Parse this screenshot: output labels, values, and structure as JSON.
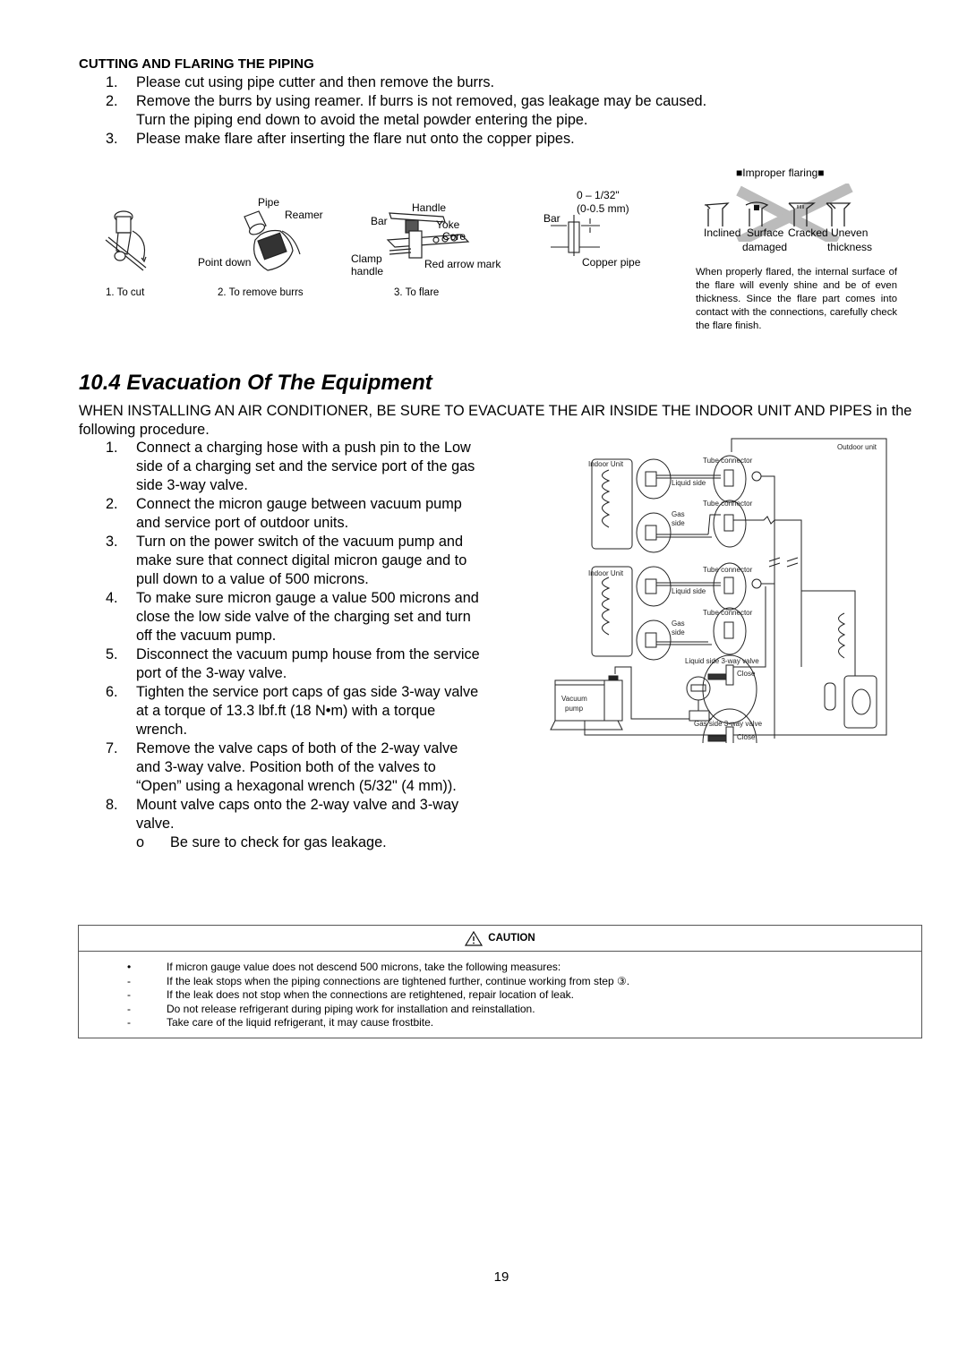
{
  "cutting": {
    "heading": "CUTTING AND FLARING THE PIPING",
    "steps": [
      {
        "num": "1.",
        "lines": [
          "Please cut using pipe cutter and then remove the burrs."
        ]
      },
      {
        "num": "2.",
        "lines": [
          "Remove the burrs by using reamer. If burrs is not removed, gas leakage may be caused.",
          "Turn the piping end down to avoid the metal powder entering the pipe."
        ]
      },
      {
        "num": "3.",
        "lines": [
          "Please make flare after inserting the flare nut onto the copper pipes."
        ]
      }
    ],
    "figures": {
      "cut_caption": "1.  To cut",
      "burrs": {
        "caption": "2.  To remove burrs",
        "pipe": "Pipe",
        "reamer": "Reamer",
        "point_down": "Point down"
      },
      "flare": {
        "caption": "3.  To flare",
        "handle": "Handle",
        "bar": "Bar",
        "yoke": "Yoke",
        "core": "Core",
        "clamp": "Clamp",
        "clamp2": "handle",
        "red_arrow": "Red arrow mark"
      },
      "gap": {
        "dim1": "0 – 1/32\"",
        "dim2": "(0-0.5 mm)",
        "bar": "Bar",
        "copper": "Copper pipe"
      },
      "improper": {
        "title": "Improper flaring",
        "types": [
          {
            "l1": "Inclined",
            "l2": ""
          },
          {
            "l1": "Surface",
            "l2": "damaged"
          },
          {
            "l1": "Cracked",
            "l2": ""
          },
          {
            "l1": "Uneven",
            "l2": "thickness"
          }
        ],
        "note": "When properly flared, the internal surface of the flare will evenly shine and be of even thickness. Since the flare part comes into contact with the connections, carefully check the flare finish."
      }
    }
  },
  "evacuation": {
    "title": "10.4  Evacuation Of The Equipment",
    "intro": "WHEN INSTALLING AN AIR CONDITIONER, BE SURE TO EVACUATE THE AIR INSIDE THE INDOOR UNIT AND PIPES in the following procedure.",
    "steps": [
      {
        "num": "1.",
        "text": "Connect a charging hose with a push pin to the Low side of a charging set and the service port of the gas side 3-way valve."
      },
      {
        "num": "2.",
        "text": "Connect the micron gauge between vacuum pump and service port of outdoor units."
      },
      {
        "num": "3.",
        "text": "Turn on the power switch of the vacuum pump and make sure that connect digital micron gauge and to pull down to a value of 500 microns."
      },
      {
        "num": "4.",
        "text": "To make sure micron gauge a value 500 microns and close the low side valve of the charging set and turn off the vacuum pump."
      },
      {
        "num": "5.",
        "text": "Disconnect the vacuum pump house from the service port of the 3-way valve."
      },
      {
        "num": "6.",
        "text": "Tighten the service port caps of gas side 3-way valve at a torque of 13.3 lbf.ft (18 N•m) with a torque wrench."
      },
      {
        "num": "7.",
        "text": "Remove the valve caps of both of the 2-way valve and 3-way valve. Position both of the valves to “Open” using a hexagonal wrench (5/32\" (4 mm))."
      },
      {
        "num": "8.",
        "text": "Mount valve caps onto the 2-way valve and 3-way valve."
      }
    ],
    "sub_bullet": {
      "mark": "o",
      "text": "Be sure to check for gas leakage."
    },
    "diagram": {
      "outdoor_unit": "Outdoor unit",
      "indoor_unit": "Indoor Unit",
      "tube_connector": "Tube connector",
      "liquid_side": "Liquid side",
      "gas": "Gas",
      "side": "side",
      "liquid_valve": "Liquid side 3-way valve",
      "gas_valve": "Gas side 3-way valve",
      "close": "Close",
      "vacuum": "Vacuum",
      "pump": "pump"
    }
  },
  "caution": {
    "title": "CAUTION",
    "items": [
      {
        "mark": "•",
        "text": "If micron gauge value does not descend 500 microns, take the following measures:"
      },
      {
        "mark": "-",
        "text": "If the leak stops when the piping connections are tightened further, continue working from step ③."
      },
      {
        "mark": "-",
        "text": "If the leak does not stop when the connections are retightened, repair location of leak."
      },
      {
        "mark": "-",
        "text": "Do not release refrigerant during piping work for installation and reinstallation."
      },
      {
        "mark": "-",
        "text": "Take care of the liquid refrigerant, it may cause frostbite."
      }
    ]
  },
  "page_number": "19"
}
